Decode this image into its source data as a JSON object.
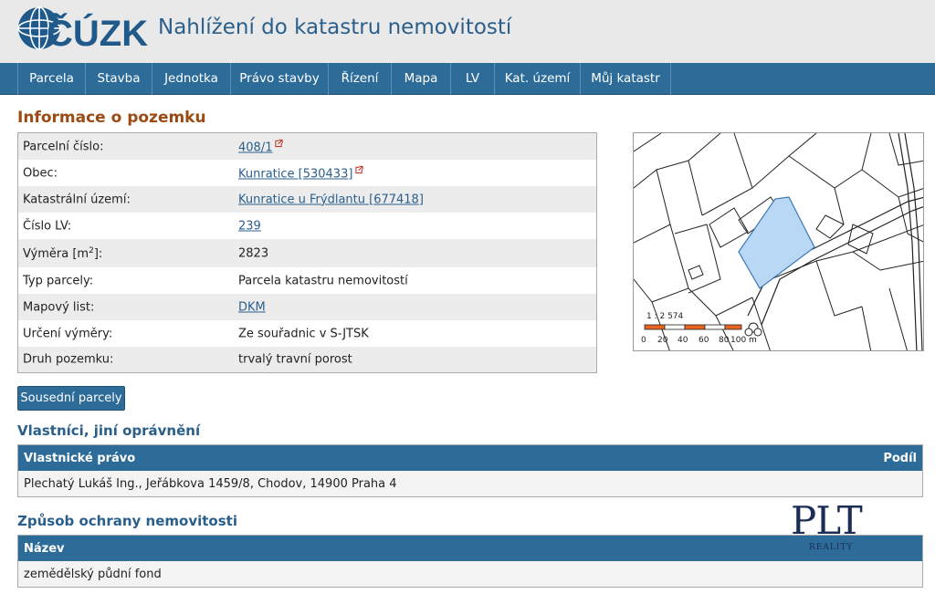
{
  "header": {
    "logo_text": "ČÚZK",
    "title": "Nahlížení do katastru nemovitostí"
  },
  "nav": {
    "items": [
      {
        "label": "Parcela"
      },
      {
        "label": "Stavba"
      },
      {
        "label": "Jednotka"
      },
      {
        "label": "Právo stavby"
      },
      {
        "label": "Řízení"
      },
      {
        "label": "Mapa"
      },
      {
        "label": "LV"
      },
      {
        "label": "Kat. území"
      },
      {
        "label": "Můj katastr"
      }
    ]
  },
  "parcel_info": {
    "heading": "Informace o pozemku",
    "rows": [
      {
        "label": "Parcelní číslo:",
        "value": "408/1",
        "link": true
      },
      {
        "label": "Obec:",
        "value": "Kunratice [530433]",
        "link": true
      },
      {
        "label": "Katastrální území:",
        "value": "Kunratice u Frýdlantu [677418]",
        "link": true
      },
      {
        "label": "Číslo LV:",
        "value": "239",
        "link": true
      },
      {
        "label": "Výměra [m",
        "label_sup": "2",
        "label_end": "]:",
        "value": "2823",
        "link": false
      },
      {
        "label": "Typ parcely:",
        "value": "Parcela katastru nemovitostí",
        "link": false
      },
      {
        "label": "Mapový list:",
        "value": "DKM",
        "link": true
      },
      {
        "label": "Určení výměry:",
        "value": "Ze souřadnic v S-JTSK",
        "link": false
      },
      {
        "label": "Druh pozemku:",
        "value": "trvalý travní porost",
        "link": false
      }
    ]
  },
  "map": {
    "scale_text": "1 : 2 574",
    "scale_ticks": [
      "0",
      "20",
      "40",
      "60",
      "80",
      "100 m"
    ],
    "highlight_color": "#b9d8f5",
    "bar_color": "#e8641e"
  },
  "buttons": {
    "neighbors": "Sousední parcely"
  },
  "owners": {
    "heading": "Vlastníci, jiní oprávnění",
    "col_left": "Vlastnické právo",
    "col_right": "Podíl",
    "rows": [
      "Plechatý Lukáš Ing., Jeřábkova 1459/8, Chodov, 14900 Praha 4"
    ]
  },
  "protection": {
    "heading": "Způsob ochrany nemovitosti",
    "col_left": "Název",
    "rows": [
      "zemědělský půdní fond"
    ]
  },
  "watermark": {
    "big": "PLT",
    "small": "REALITY"
  },
  "colors": {
    "nav_bg": "#2d6c99",
    "heading_main": "#9a4a12",
    "heading_sub": "#2a5f8c"
  }
}
